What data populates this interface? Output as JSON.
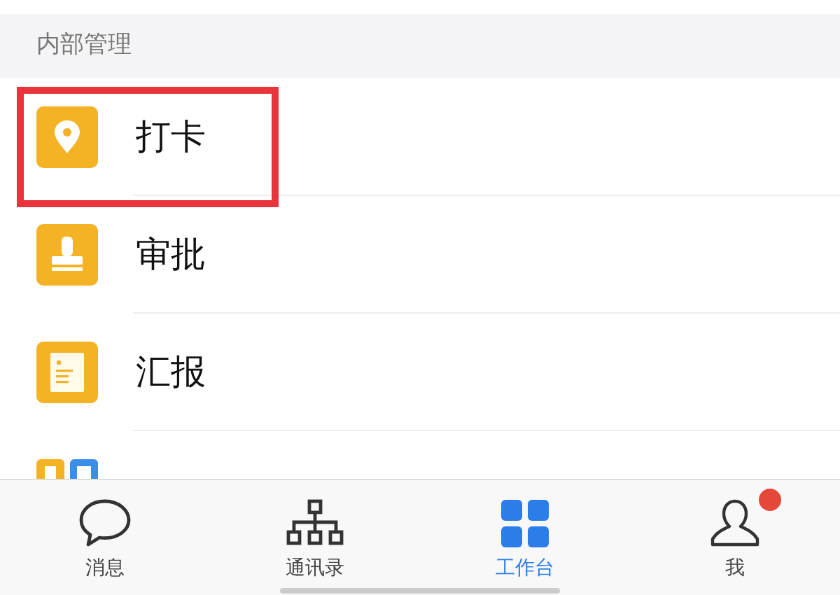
{
  "section": {
    "title": "内部管理"
  },
  "items": [
    {
      "kind": "pin",
      "label": "打卡",
      "highlighted": true
    },
    {
      "kind": "stamp",
      "label": "审批",
      "highlighted": false
    },
    {
      "kind": "report",
      "label": "汇报",
      "highlighted": false
    },
    {
      "kind": "apps",
      "highlighted": false
    }
  ],
  "tab_bar": [
    {
      "kind": "chat",
      "label": "消息",
      "selected": false,
      "badge": false
    },
    {
      "kind": "org",
      "label": "通讯录",
      "selected": false,
      "badge": false
    },
    {
      "kind": "grid",
      "label": "工作台",
      "selected": true,
      "badge": false
    },
    {
      "kind": "person",
      "label": "我",
      "selected": false,
      "badge": true
    }
  ]
}
